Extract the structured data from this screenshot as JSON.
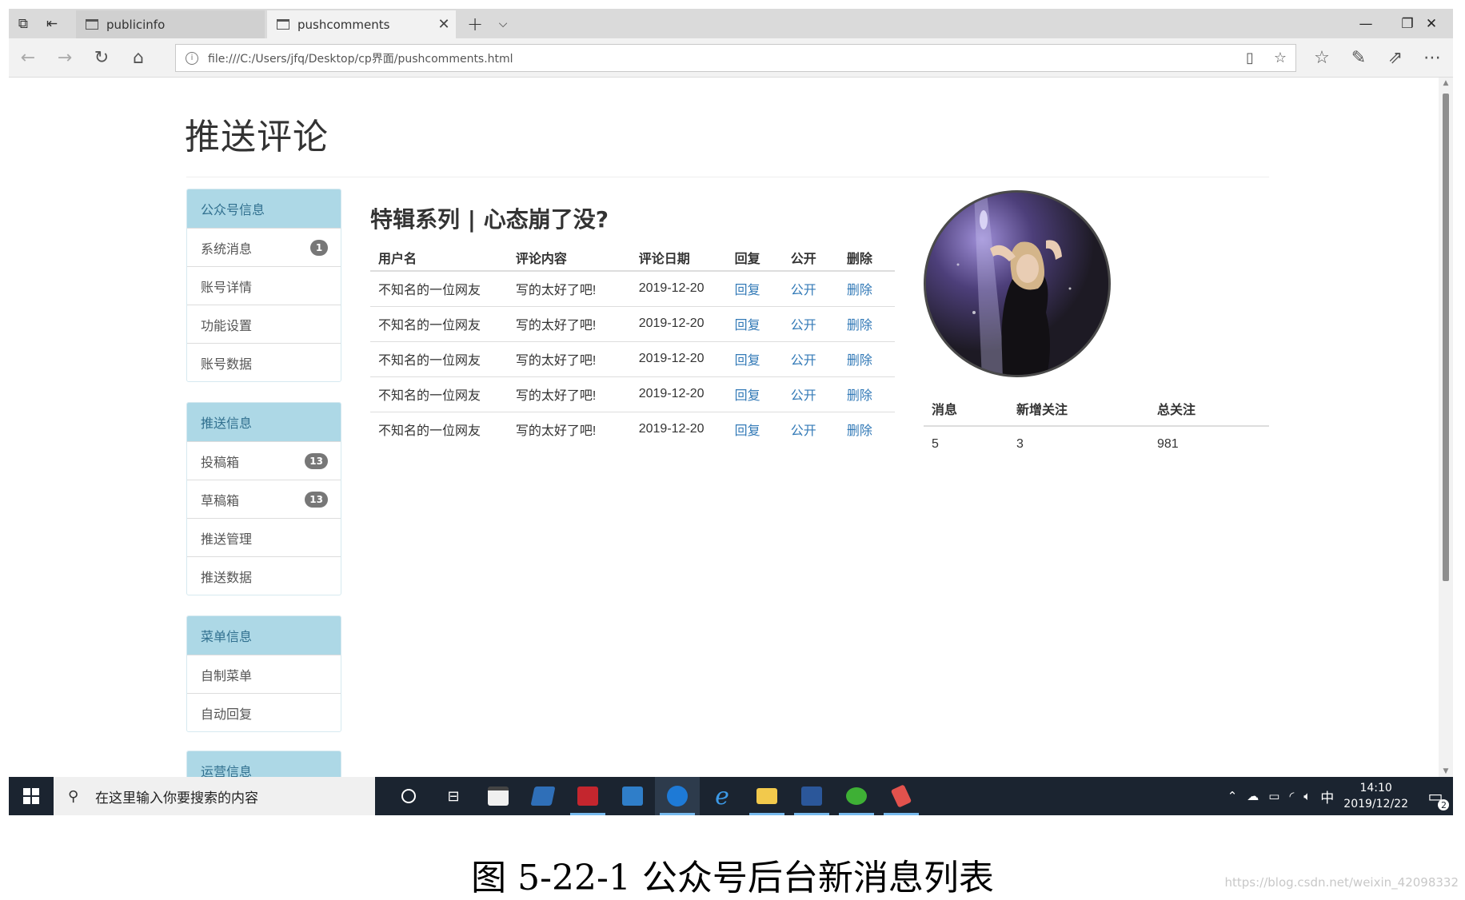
{
  "browser": {
    "tabs": [
      {
        "title": "publicinfo"
      },
      {
        "title": "pushcomments"
      }
    ],
    "url": "file:///C:/Users/jfq/Desktop/cp界面/pushcomments.html"
  },
  "page": {
    "title": "推送评论",
    "sidebar": [
      {
        "heading": "公众号信息",
        "items": [
          {
            "label": "系统消息",
            "badge": "1"
          },
          {
            "label": "账号详情"
          },
          {
            "label": "功能设置"
          },
          {
            "label": "账号数据"
          }
        ]
      },
      {
        "heading": "推送信息",
        "items": [
          {
            "label": "投稿箱",
            "badge": "13"
          },
          {
            "label": "草稿箱",
            "badge": "13"
          },
          {
            "label": "推送管理"
          },
          {
            "label": "推送数据"
          }
        ]
      },
      {
        "heading": "菜单信息",
        "items": [
          {
            "label": "自制菜单"
          },
          {
            "label": "自动回复"
          }
        ]
      },
      {
        "heading": "运营信息",
        "items": []
      }
    ],
    "article_title": "特辑系列 | 心态崩了没?",
    "comments": {
      "headers": [
        "用户名",
        "评论内容",
        "评论日期",
        "回复",
        "公开",
        "删除"
      ],
      "rows": [
        [
          "不知名的一位网友",
          "写的太好了吧!",
          "2019-12-20",
          "回复",
          "公开",
          "删除"
        ],
        [
          "不知名的一位网友",
          "写的太好了吧!",
          "2019-12-20",
          "回复",
          "公开",
          "删除"
        ],
        [
          "不知名的一位网友",
          "写的太好了吧!",
          "2019-12-20",
          "回复",
          "公开",
          "删除"
        ],
        [
          "不知名的一位网友",
          "写的太好了吧!",
          "2019-12-20",
          "回复",
          "公开",
          "删除"
        ],
        [
          "不知名的一位网友",
          "写的太好了吧!",
          "2019-12-20",
          "回复",
          "公开",
          "删除"
        ]
      ]
    },
    "stats": {
      "headers": [
        "消息",
        "新增关注",
        "总关注"
      ],
      "values": [
        "5",
        "3",
        "981"
      ]
    }
  },
  "taskbar": {
    "search_placeholder": "在这里输入你要搜索的内容",
    "ime": "中",
    "time": "14:10",
    "date": "2019/12/22",
    "notification_count": "2"
  },
  "caption": "图 5-22-1 公众号后台新消息列表",
  "watermark": "https://blog.csdn.net/weixin_42098332",
  "colors": {
    "panel_heading_bg": "#add8e6",
    "link": "#337ab7",
    "badge": "#777777",
    "taskbar": "#1b2430"
  }
}
